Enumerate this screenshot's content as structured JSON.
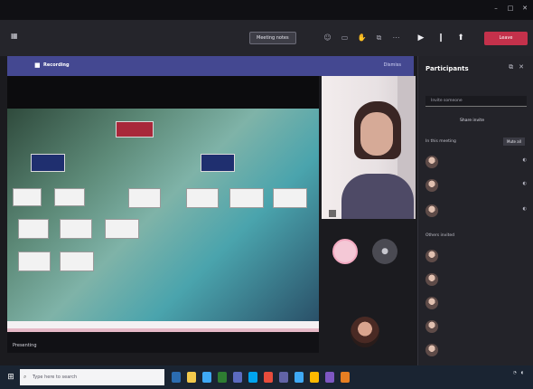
{
  "window": {
    "title": "",
    "controls": [
      "–",
      "□",
      "✕"
    ]
  },
  "toolbar": {
    "timer": "",
    "meeting_button": "Meeting notes",
    "leave_label": "Leave"
  },
  "banner": {
    "title": "Recording",
    "message": "",
    "dismiss": "Dismiss"
  },
  "stage": {
    "presenter_label": "Presenting",
    "slide": {
      "top_box": "",
      "branch_left": "",
      "branch_right": "",
      "left_row": [
        "",
        ""
      ],
      "mid_box": "",
      "right_row": [
        "",
        "",
        ""
      ],
      "lower_left": [
        "",
        "",
        ""
      ],
      "lower_left2": [
        "",
        ""
      ]
    }
  },
  "video": {
    "main_name": "",
    "mini_label": "",
    "avatar_pink_initials": "",
    "avatar_gray_icon": "person-icon"
  },
  "panel": {
    "title": "Participants",
    "invite_placeholder": "Invite someone",
    "share_invite": "Share invite",
    "in_meeting_label": "In this meeting",
    "mute_all": "Mute all",
    "others_label": "Others invited",
    "in_meeting": [
      {
        "name": "",
        "role": ""
      },
      {
        "name": "",
        "role": ""
      },
      {
        "name": "",
        "role": ""
      }
    ],
    "others": [
      {
        "name": "",
        "role": ""
      },
      {
        "name": "",
        "role": ""
      },
      {
        "name": "",
        "role": ""
      },
      {
        "name": "",
        "role": ""
      },
      {
        "name": "",
        "role": ""
      }
    ]
  },
  "taskbar": {
    "search_placeholder": "Type here to search",
    "time": "",
    "date": "",
    "app_colors": [
      "#2b6cb0",
      "#f2c94c",
      "#3fa9f5",
      "#2e7d32",
      "#5c6bc0",
      "#00a4ef",
      "#e74c3c",
      "#6264a7",
      "#3fa9f5",
      "#ffb900",
      "#7e57c2",
      "#e67e22"
    ]
  }
}
